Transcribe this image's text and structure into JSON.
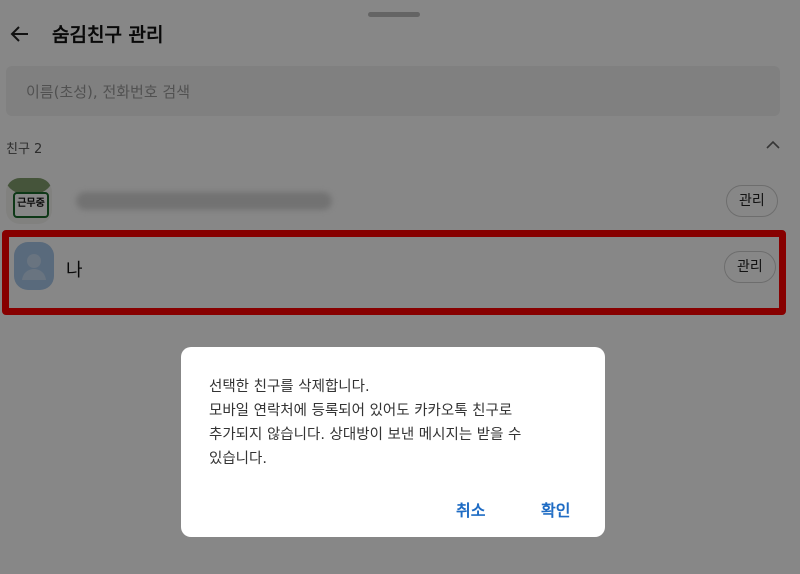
{
  "header": {
    "title": "숨김친구 관리",
    "back_icon": "back-arrow-icon"
  },
  "search": {
    "placeholder": "이름(초성), 전화번호 검색"
  },
  "section": {
    "label": "친구 2",
    "collapse_icon": "chevron-up-icon"
  },
  "friends": [
    {
      "name": "",
      "avatar_text": "근무중",
      "manage_label": "관리"
    },
    {
      "name": "나",
      "avatar_icon": "default-profile-icon",
      "manage_label": "관리"
    }
  ],
  "dialog": {
    "message": "선택한 친구를 삭제합니다.\n모바일 연락처에 등록되어 있어도 카카오톡 친구로\n추가되지 않습니다. 상대방이 보낸 메시지는 받을 수\n있습니다.",
    "cancel_label": "취소",
    "confirm_label": "확인"
  },
  "colors": {
    "accent": "#1f6cc4",
    "highlight": "#ff0000",
    "overlay": "rgba(0,0,0,0.47)"
  }
}
